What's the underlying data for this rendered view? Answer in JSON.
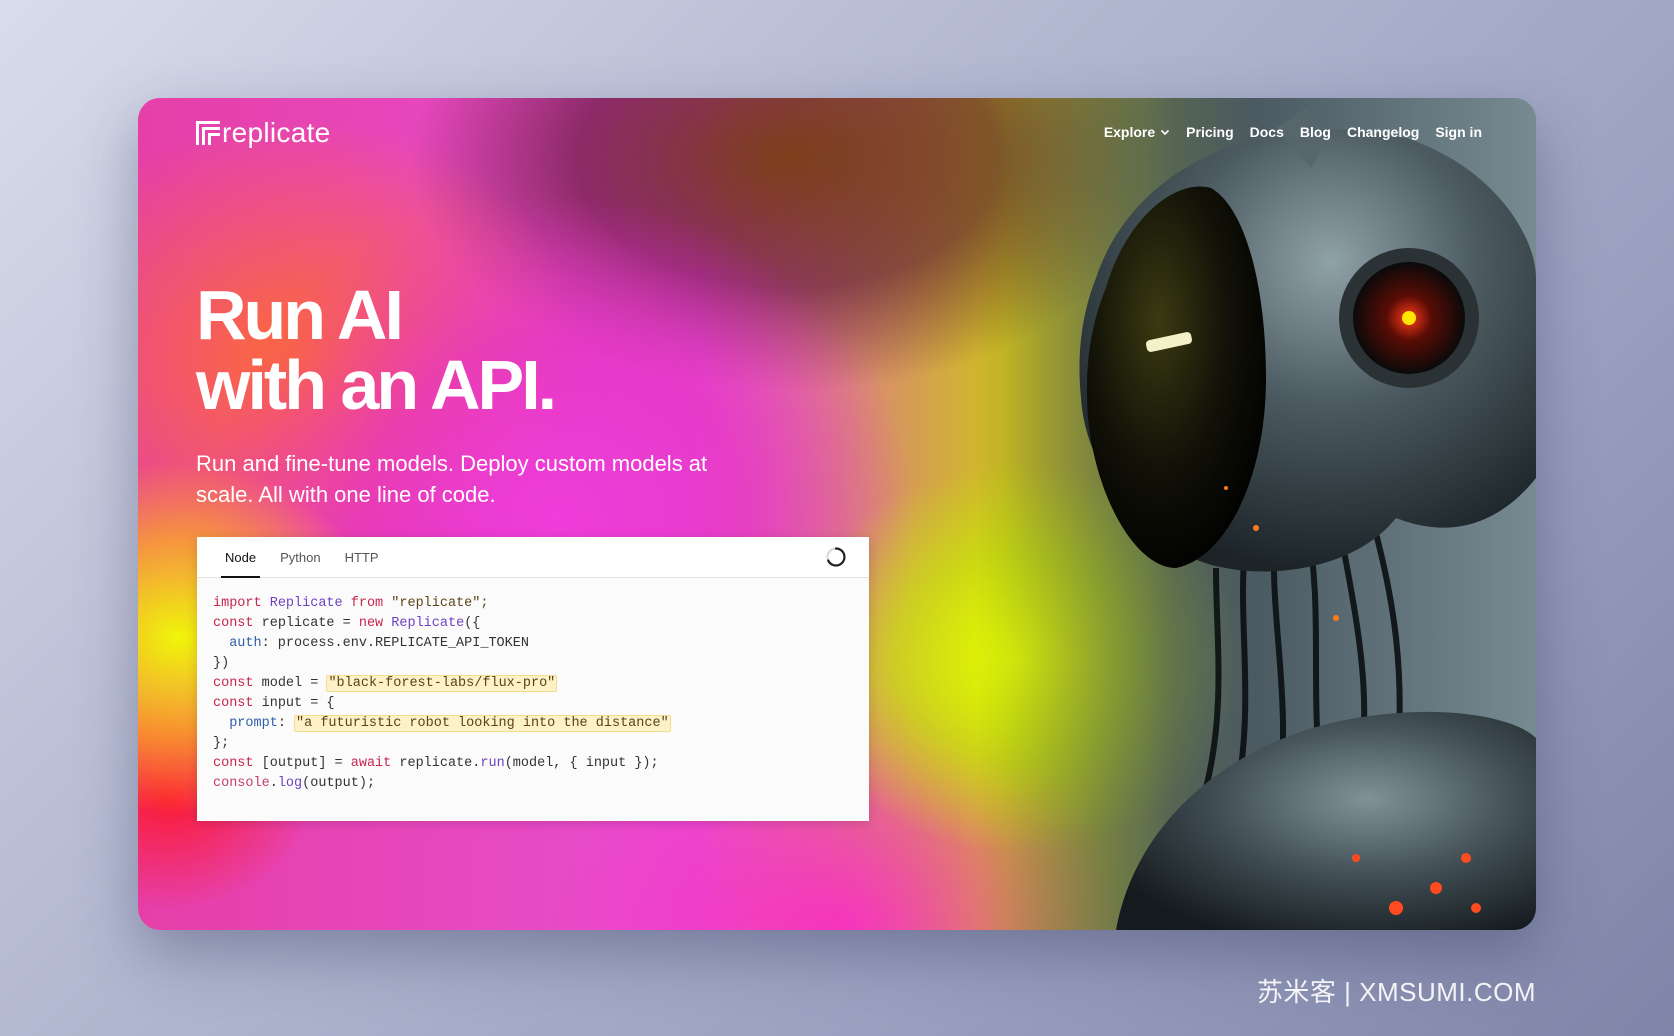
{
  "brand": {
    "name": "replicate"
  },
  "nav": {
    "items": [
      {
        "label": "Explore",
        "has_dropdown": true
      },
      {
        "label": "Pricing"
      },
      {
        "label": "Docs"
      },
      {
        "label": "Blog"
      },
      {
        "label": "Changelog"
      },
      {
        "label": "Sign in"
      }
    ]
  },
  "hero": {
    "title_line1": "Run AI",
    "title_line2": "with an API.",
    "subtitle": "Run and fine-tune models. Deploy custom models at scale. All with one line of code."
  },
  "code_card": {
    "tabs": [
      {
        "label": "Node",
        "active": true
      },
      {
        "label": "Python",
        "active": false
      },
      {
        "label": "HTTP",
        "active": false
      }
    ],
    "status_icon": "loading-spinner-icon",
    "code": {
      "l1_import": "import",
      "l1_class": "Replicate",
      "l1_from": "from",
      "l1_module": "\"replicate\";",
      "l2_const": "const",
      "l2_rest": "replicate = ",
      "l2_new": "new",
      "l2_class": "Replicate",
      "l2_end": "({",
      "l3_prop": "auth",
      "l3_rest": ": process.env.REPLICATE_API_TOKEN",
      "l4": "})",
      "l5_const": "const",
      "l5_rest": "model = ",
      "l5_value": "\"black-forest-labs/flux-pro\"",
      "l6_const": "const",
      "l6_rest": "input = {",
      "l7_prop": "prompt",
      "l7_colon": ": ",
      "l7_value": "\"a futuristic robot looking into the distance\"",
      "l8": "};",
      "l9_const": "const",
      "l9_rest": "[output] = ",
      "l9_await": "await",
      "l9_obj": "replicate.",
      "l9_fn": "run",
      "l9_end": "(model, { input });",
      "l10_obj": "console",
      "l10_dot": ".",
      "l10_fn": "log",
      "l10_end": "(output);"
    }
  },
  "watermark": "苏米客 | XMSUMI.COM",
  "colors": {
    "text_on_hero": "#ffffff",
    "code_bg": "#fbfbfb",
    "highlight_bg": "#fdf1c7"
  }
}
